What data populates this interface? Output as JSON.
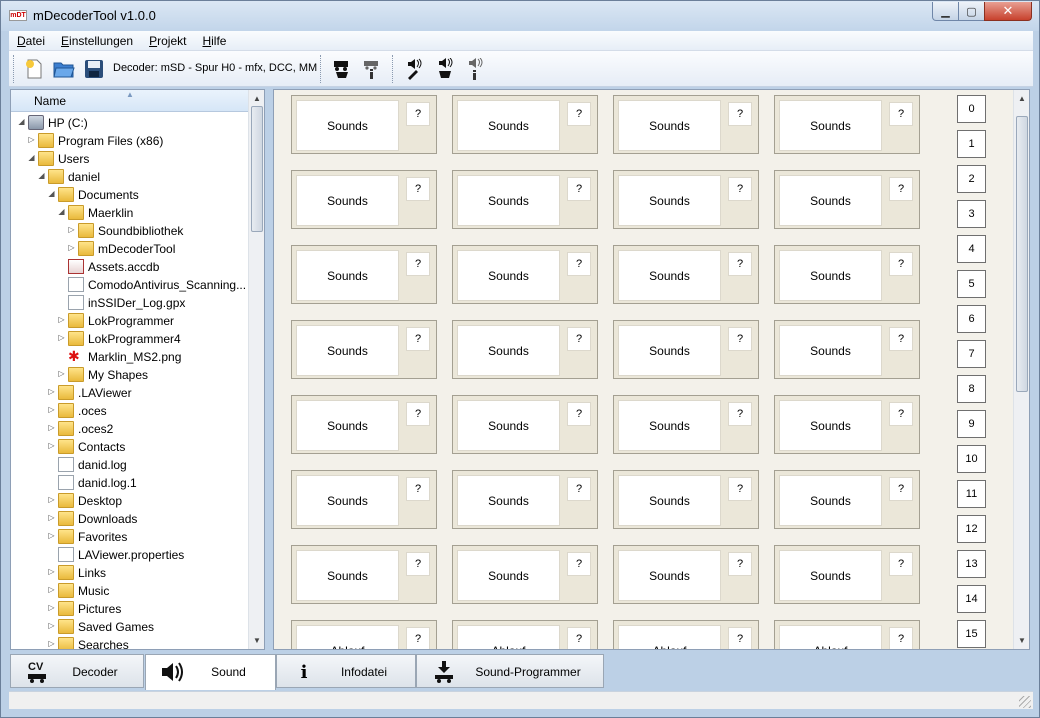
{
  "window": {
    "title": "mDecoderTool v1.0.0",
    "logo_text": "mDT"
  },
  "menu": [
    "Datei",
    "Einstellungen",
    "Projekt",
    "Hilfe"
  ],
  "toolbar": {
    "decoder_label": "Decoder: mSD - Spur H0 - mfx, DCC, MM"
  },
  "tree": {
    "header": "Name",
    "items": [
      {
        "label": "HP (C:)",
        "icon": "drive-icon",
        "depth": 0,
        "expander": "open"
      },
      {
        "label": "Program Files (x86)",
        "icon": "folder-icon",
        "depth": 1,
        "expander": "closed"
      },
      {
        "label": "Users",
        "icon": "folder-icon",
        "depth": 1,
        "expander": "open"
      },
      {
        "label": "daniel",
        "icon": "user-folder-icon",
        "depth": 2,
        "expander": "open"
      },
      {
        "label": "Documents",
        "icon": "documents-folder-icon",
        "depth": 3,
        "expander": "open"
      },
      {
        "label": "Maerklin",
        "icon": "folder-icon",
        "depth": 4,
        "expander": "open"
      },
      {
        "label": "Soundbibliothek",
        "icon": "folder-icon",
        "depth": 5,
        "expander": "closed"
      },
      {
        "label": "mDecoderTool",
        "icon": "folder-icon",
        "depth": 5,
        "expander": "closed"
      },
      {
        "label": "Assets.accdb",
        "icon": "access-file-icon",
        "depth": 4,
        "expander": ""
      },
      {
        "label": "ComodoAntivirus_Scanning...",
        "icon": "file-icon",
        "depth": 4,
        "expander": ""
      },
      {
        "label": "inSSIDer_Log.gpx",
        "icon": "file-icon",
        "depth": 4,
        "expander": ""
      },
      {
        "label": "LokProgrammer",
        "icon": "folder-icon",
        "depth": 4,
        "expander": "closed"
      },
      {
        "label": "LokProgrammer4",
        "icon": "folder-icon",
        "depth": 4,
        "expander": "closed"
      },
      {
        "label": "Marklin_MS2.png",
        "icon": "image-file-icon",
        "depth": 4,
        "expander": ""
      },
      {
        "label": "My Shapes",
        "icon": "shapes-folder-icon",
        "depth": 4,
        "expander": "closed"
      },
      {
        "label": ".LAViewer",
        "icon": "folder-icon",
        "depth": 3,
        "expander": "closed"
      },
      {
        "label": ".oces",
        "icon": "folder-icon",
        "depth": 3,
        "expander": "closed"
      },
      {
        "label": ".oces2",
        "icon": "folder-icon",
        "depth": 3,
        "expander": "closed"
      },
      {
        "label": "Contacts",
        "icon": "contacts-folder-icon",
        "depth": 3,
        "expander": "closed"
      },
      {
        "label": "danid.log",
        "icon": "file-icon",
        "depth": 3,
        "expander": ""
      },
      {
        "label": "danid.log.1",
        "icon": "file-icon",
        "depth": 3,
        "expander": ""
      },
      {
        "label": "Desktop",
        "icon": "desktop-folder-icon",
        "depth": 3,
        "expander": "closed"
      },
      {
        "label": "Downloads",
        "icon": "downloads-folder-icon",
        "depth": 3,
        "expander": "closed"
      },
      {
        "label": "Favorites",
        "icon": "favorites-folder-icon",
        "depth": 3,
        "expander": "closed"
      },
      {
        "label": "LAViewer.properties",
        "icon": "file-icon",
        "depth": 3,
        "expander": ""
      },
      {
        "label": "Links",
        "icon": "links-folder-icon",
        "depth": 3,
        "expander": "closed"
      },
      {
        "label": "Music",
        "icon": "music-folder-icon",
        "depth": 3,
        "expander": "closed"
      },
      {
        "label": "Pictures",
        "icon": "pictures-folder-icon",
        "depth": 3,
        "expander": "closed"
      },
      {
        "label": "Saved Games",
        "icon": "games-folder-icon",
        "depth": 3,
        "expander": "closed"
      },
      {
        "label": "Searches",
        "icon": "searches-folder-icon",
        "depth": 3,
        "expander": "closed"
      }
    ]
  },
  "grid": {
    "rows": [
      [
        "Sounds",
        "Sounds",
        "Sounds",
        "Sounds"
      ],
      [
        "Sounds",
        "Sounds",
        "Sounds",
        "Sounds"
      ],
      [
        "Sounds",
        "Sounds",
        "Sounds",
        "Sounds"
      ],
      [
        "Sounds",
        "Sounds",
        "Sounds",
        "Sounds"
      ],
      [
        "Sounds",
        "Sounds",
        "Sounds",
        "Sounds"
      ],
      [
        "Sounds",
        "Sounds",
        "Sounds",
        "Sounds"
      ],
      [
        "Sounds",
        "Sounds",
        "Sounds",
        "Sounds"
      ],
      [
        "Ablauf",
        "Ablauf",
        "Ablauf",
        "Ablauf"
      ]
    ],
    "help_label": "?"
  },
  "numbers": [
    "0",
    "1",
    "2",
    "3",
    "4",
    "5",
    "6",
    "7",
    "8",
    "9",
    "10",
    "11",
    "12",
    "13",
    "14",
    "15"
  ],
  "tabs": [
    {
      "label": "Decoder",
      "icon": "cv-decoder-icon",
      "icon_text": "CV",
      "active": false
    },
    {
      "label": "Sound",
      "icon": "speaker-icon",
      "icon_text": "",
      "active": true
    },
    {
      "label": "Infodatei",
      "icon": "info-icon",
      "icon_text": "i",
      "active": false
    },
    {
      "label": "Sound-Programmer",
      "icon": "download-icon",
      "icon_text": "",
      "active": false
    }
  ]
}
